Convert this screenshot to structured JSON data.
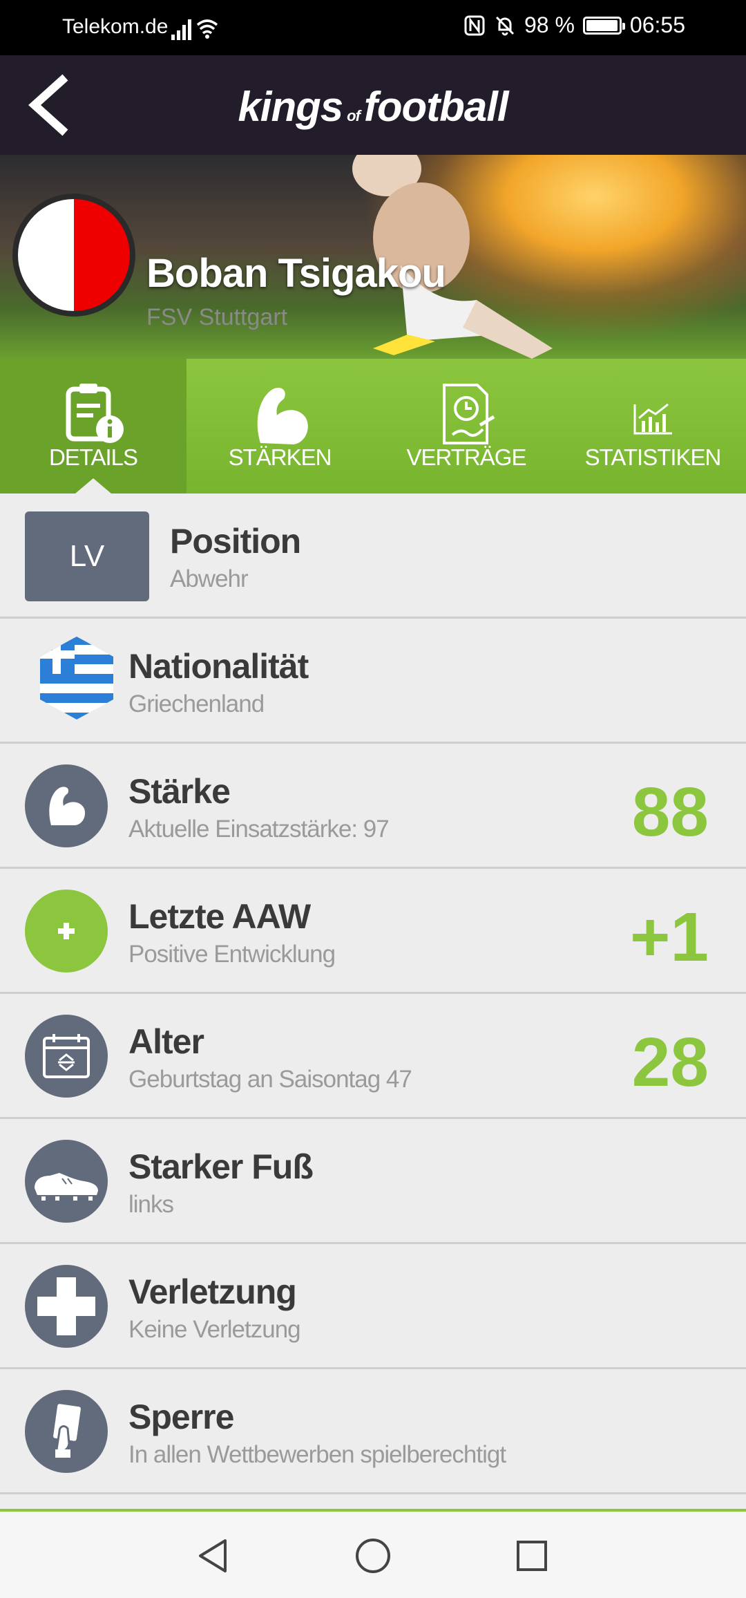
{
  "status_bar": {
    "carrier": "Telekom.de",
    "battery": "98 %",
    "time": "06:55",
    "battery_level": 0.98
  },
  "app": {
    "back_icon": "chevron-left-icon",
    "logo": {
      "kings": "kings",
      "of": "of",
      "football": "football"
    }
  },
  "player": {
    "name": "Boban Tsigakou",
    "club": "FSV Stuttgart",
    "crest_colors": [
      "#ffffff",
      "#ee0000"
    ]
  },
  "tabs": [
    {
      "label": "DETAILS",
      "icon": "details-clipboard-icon",
      "active": true
    },
    {
      "label": "STÄRKEN",
      "icon": "strength-arm-icon",
      "active": false
    },
    {
      "label": "VERTRÄGE",
      "icon": "contract-icon",
      "active": false
    },
    {
      "label": "STATISTIKEN",
      "icon": "chart-icon",
      "active": false
    }
  ],
  "details": {
    "position": {
      "badge": "LV",
      "title": "Position",
      "subtitle": "Abwehr"
    },
    "nationality": {
      "title": "Nationalität",
      "subtitle": "Griechenland",
      "icon": "greece-flag-icon"
    },
    "strength": {
      "title": "Stärke",
      "subtitle": "Aktuelle Einsatzstärke: 97",
      "value": "88",
      "icon": "arm-icon"
    },
    "last_aaw": {
      "title": "Letzte AAW",
      "subtitle": "Positive Entwicklung",
      "value": "+1",
      "icon": "plus-icon"
    },
    "age": {
      "title": "Alter",
      "subtitle": "Geburtstag an Saisontag 47",
      "value": "28",
      "icon": "calendar-icon"
    },
    "foot": {
      "title": "Starker Fuß",
      "subtitle": "links",
      "icon": "football-boot-icon"
    },
    "injury": {
      "title": "Verletzung",
      "subtitle": "Keine Verletzung",
      "icon": "medical-cross-icon"
    },
    "suspension": {
      "title": "Sperre",
      "subtitle": "In allen Wettbewerben spielberechtigt",
      "icon": "red-card-icon"
    }
  },
  "colors": {
    "accent_green": "#8cc63f",
    "header_dark": "#221c2b",
    "icon_gray": "#626b7b"
  },
  "nav": {
    "back": "nav-back-icon",
    "home": "nav-home-icon",
    "recents": "nav-recents-icon"
  }
}
